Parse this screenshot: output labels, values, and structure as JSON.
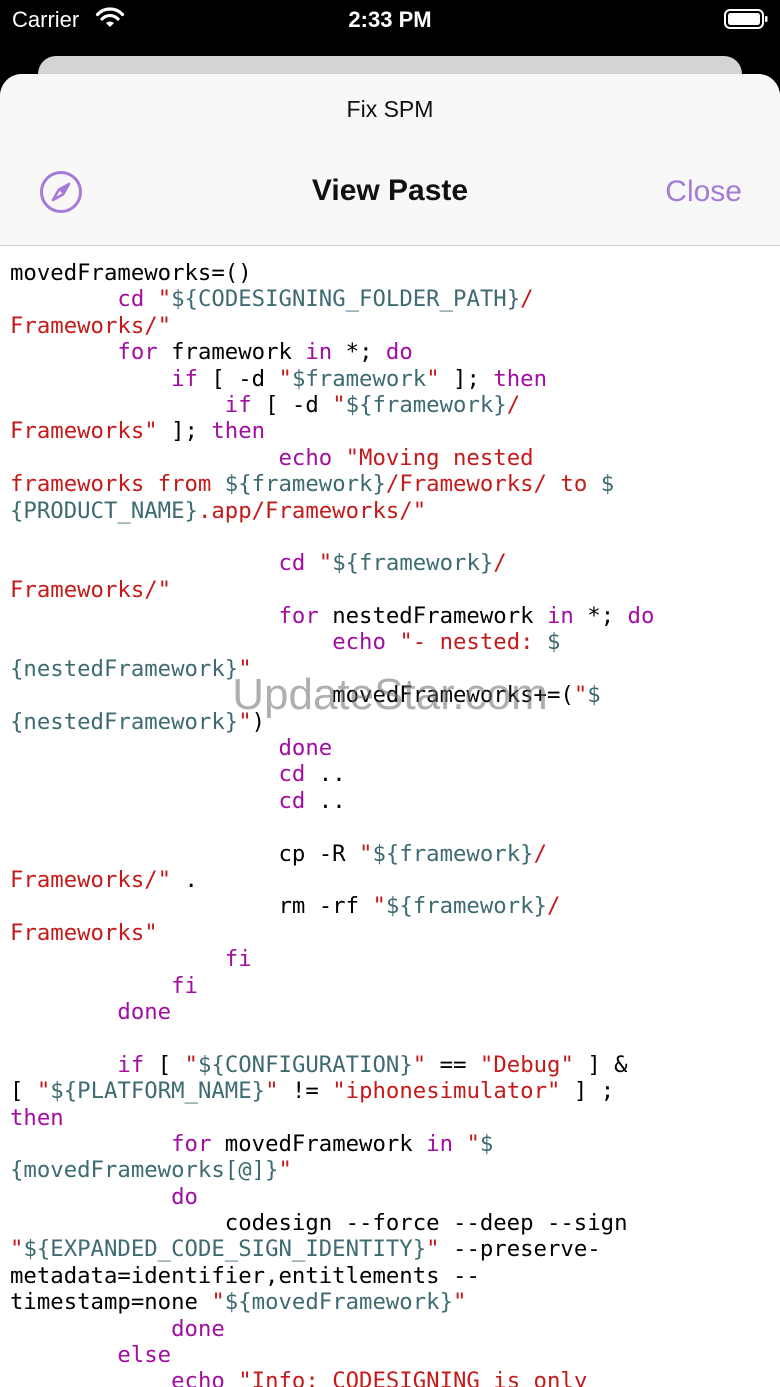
{
  "status": {
    "carrier": "Carrier",
    "time": "2:33 PM"
  },
  "nav": {
    "subtitle": "Fix SPM",
    "title": "View Paste",
    "close_label": "Close",
    "compass_icon": "compass-icon"
  },
  "watermark": "UpdateStar.com",
  "code_lines": [
    [
      [
        "",
        "movedFrameworks=()"
      ]
    ],
    [
      [
        "",
        "        "
      ],
      [
        "kw",
        "cd"
      ],
      [
        "",
        ""
      ],
      [
        "str",
        " \""
      ],
      [
        "var",
        "${CODESIGNING_FOLDER_PATH}"
      ],
      [
        "str",
        "/"
      ]
    ],
    [
      [
        "str",
        "Frameworks/\""
      ]
    ],
    [
      [
        "",
        "        "
      ],
      [
        "kw",
        "for"
      ],
      [
        "",
        " framework "
      ],
      [
        "kw",
        "in"
      ],
      [
        "",
        " *; "
      ],
      [
        "kw",
        "do"
      ]
    ],
    [
      [
        "",
        "            "
      ],
      [
        "kw",
        "if"
      ],
      [
        "",
        " [ -d "
      ],
      [
        "str",
        "\""
      ],
      [
        "var",
        "$framework"
      ],
      [
        "str",
        "\""
      ],
      [
        "",
        " ]; "
      ],
      [
        "kw",
        "then"
      ]
    ],
    [
      [
        "",
        "                "
      ],
      [
        "kw",
        "if"
      ],
      [
        "",
        " [ -d "
      ],
      [
        "str",
        "\""
      ],
      [
        "var",
        "${framework}"
      ],
      [
        "str",
        "/"
      ]
    ],
    [
      [
        "str",
        "Frameworks\""
      ],
      [
        "",
        " ]; "
      ],
      [
        "kw",
        "then"
      ]
    ],
    [
      [
        "",
        "                    "
      ],
      [
        "kw",
        "echo"
      ],
      [
        "str",
        " \"Moving nested"
      ]
    ],
    [
      [
        "str",
        "frameworks from "
      ],
      [
        "var",
        "${framework}"
      ],
      [
        "str",
        "/Frameworks/ to "
      ],
      [
        "var",
        "$"
      ]
    ],
    [
      [
        "var",
        "{PRODUCT_NAME}"
      ],
      [
        "str",
        ".app/Frameworks/\""
      ]
    ],
    [
      [
        "",
        ""
      ]
    ],
    [
      [
        "",
        "                    "
      ],
      [
        "kw",
        "cd"
      ],
      [
        "str",
        " \""
      ],
      [
        "var",
        "${framework}"
      ],
      [
        "str",
        "/"
      ]
    ],
    [
      [
        "str",
        "Frameworks/\""
      ]
    ],
    [
      [
        "",
        "                    "
      ],
      [
        "kw",
        "for"
      ],
      [
        "",
        " nestedFramework "
      ],
      [
        "kw",
        "in"
      ],
      [
        "",
        " *; "
      ],
      [
        "kw",
        "do"
      ]
    ],
    [
      [
        "",
        "                        "
      ],
      [
        "kw",
        "echo"
      ],
      [
        "str",
        " \"- nested: "
      ],
      [
        "var",
        "$"
      ]
    ],
    [
      [
        "var",
        "{nestedFramework}"
      ],
      [
        "str",
        "\""
      ]
    ],
    [
      [
        "",
        "                        movedFrameworks+=("
      ],
      [
        "str",
        "\""
      ],
      [
        "var",
        "$"
      ]
    ],
    [
      [
        "var",
        "{nestedFramework}"
      ],
      [
        "str",
        "\""
      ],
      [
        "",
        ")"
      ]
    ],
    [
      [
        "",
        "                    "
      ],
      [
        "kw",
        "done"
      ]
    ],
    [
      [
        "",
        "                    "
      ],
      [
        "kw",
        "cd"
      ],
      [
        "",
        " .."
      ]
    ],
    [
      [
        "",
        "                    "
      ],
      [
        "kw",
        "cd"
      ],
      [
        "",
        " .."
      ]
    ],
    [
      [
        "",
        ""
      ]
    ],
    [
      [
        "",
        "                    cp -R "
      ],
      [
        "str",
        "\""
      ],
      [
        "var",
        "${framework}"
      ],
      [
        "str",
        "/"
      ]
    ],
    [
      [
        "str",
        "Frameworks/\""
      ],
      [
        "",
        " ."
      ]
    ],
    [
      [
        "",
        "                    rm -rf "
      ],
      [
        "str",
        "\""
      ],
      [
        "var",
        "${framework}"
      ],
      [
        "str",
        "/"
      ]
    ],
    [
      [
        "str",
        "Frameworks\""
      ]
    ],
    [
      [
        "",
        "                "
      ],
      [
        "kw",
        "fi"
      ]
    ],
    [
      [
        "",
        "            "
      ],
      [
        "kw",
        "fi"
      ]
    ],
    [
      [
        "",
        "        "
      ],
      [
        "kw",
        "done"
      ]
    ],
    [
      [
        "",
        ""
      ]
    ],
    [
      [
        "",
        "        "
      ],
      [
        "kw",
        "if"
      ],
      [
        "",
        " [ "
      ],
      [
        "str",
        "\""
      ],
      [
        "var",
        "${CONFIGURATION}"
      ],
      [
        "str",
        "\""
      ],
      [
        "",
        " == "
      ],
      [
        "str",
        "\"Debug\""
      ],
      [
        "",
        " ] &"
      ]
    ],
    [
      [
        "",
        "[ "
      ],
      [
        "str",
        "\""
      ],
      [
        "var",
        "${PLATFORM_NAME}"
      ],
      [
        "str",
        "\""
      ],
      [
        "",
        " != "
      ],
      [
        "str",
        "\"iphonesimulator\""
      ],
      [
        "",
        " ] ;"
      ]
    ],
    [
      [
        "kw",
        "then"
      ]
    ],
    [
      [
        "",
        "            "
      ],
      [
        "kw",
        "for"
      ],
      [
        "",
        " movedFramework "
      ],
      [
        "kw",
        "in"
      ],
      [
        "str",
        " \""
      ],
      [
        "var",
        "$"
      ]
    ],
    [
      [
        "var",
        "{movedFrameworks[@]}"
      ],
      [
        "str",
        "\""
      ]
    ],
    [
      [
        "",
        "            "
      ],
      [
        "kw",
        "do"
      ]
    ],
    [
      [
        "",
        "                codesign --force --deep --sign"
      ]
    ],
    [
      [
        "str",
        "\""
      ],
      [
        "var",
        "${EXPANDED_CODE_SIGN_IDENTITY}"
      ],
      [
        "str",
        "\""
      ],
      [
        "",
        " --preserve-"
      ]
    ],
    [
      [
        "",
        "metadata=identifier,entitlements --"
      ]
    ],
    [
      [
        "",
        "timestamp=none "
      ],
      [
        "str",
        "\""
      ],
      [
        "var",
        "${movedFramework}"
      ],
      [
        "str",
        "\""
      ]
    ],
    [
      [
        "",
        "            "
      ],
      [
        "kw",
        "done"
      ]
    ],
    [
      [
        "",
        "        "
      ],
      [
        "kw",
        "else"
      ]
    ],
    [
      [
        "",
        "            "
      ],
      [
        "kw",
        "echo"
      ],
      [
        "str",
        " \"Info: CODESIGNING is only"
      ]
    ]
  ]
}
